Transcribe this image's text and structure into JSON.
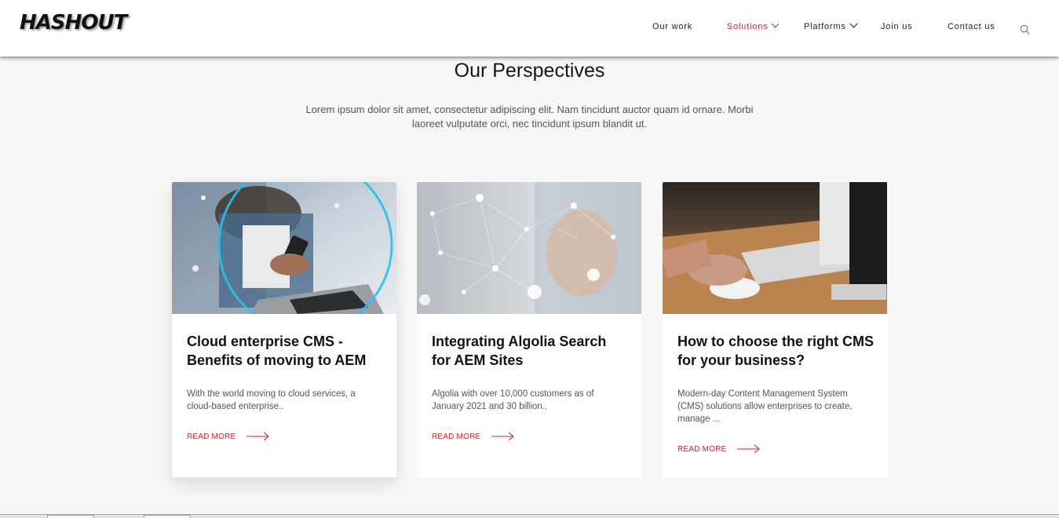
{
  "header": {
    "logo": "HASHOUT",
    "nav": [
      {
        "label": "Our work"
      },
      {
        "label": "Solutions"
      },
      {
        "label": "Platforms"
      },
      {
        "label": "Join us"
      },
      {
        "label": "Contact us"
      }
    ],
    "search_icon": "search-icon",
    "accent_color": "#d3212d"
  },
  "section": {
    "title": "Our Perspectives",
    "intro": "Lorem ipsum dolor sit amet, consectetur adipiscing elit. Nam tincidunt auctor quam id ornare. Morbi laoreet vulputate orci, nec tincidunt ipsum blandit ut."
  },
  "cards": [
    {
      "title": "Cloud enterprise CMS - Benefits of moving to AEM",
      "excerpt": "With the world moving to cloud services, a cloud-based enterprise..",
      "cta": "READ MORE"
    },
    {
      "title": "Integrating Algolia Search for AEM Sites",
      "excerpt": "Algolia with over 10,000 customers as of January 2021 and 30 billion..",
      "cta": "READ MORE"
    },
    {
      "title": "How to choose the right CMS for your business?",
      "excerpt": "Modern-day Content Management System (CMS) solutions allow enterprises to create, manage ...",
      "cta": "READ MORE"
    }
  ]
}
